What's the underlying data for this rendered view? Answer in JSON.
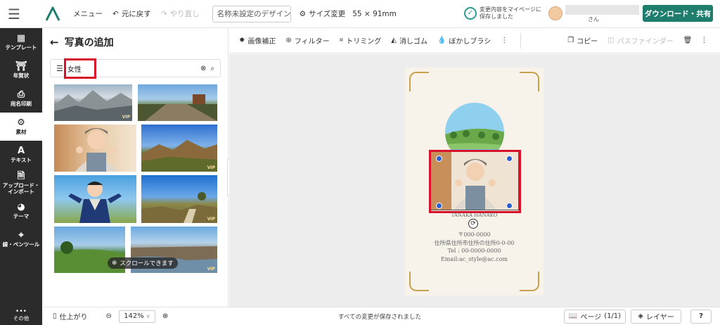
{
  "header": {
    "menu_label": "メニュー",
    "undo_label": "元に戻す",
    "redo_label": "やり直し",
    "design_title": "名称未設定のデザイン",
    "size_label": "サイズ変更",
    "size_value": "55 × 91mm",
    "saved_line1": "変更内容をマイページに",
    "saved_line2": "保存しました",
    "user_suffix": "さん",
    "download_label": "ダウンロード・共有",
    "brand_color": "#1f7d6e"
  },
  "sidebar": {
    "items": [
      {
        "icon": "template-icon",
        "label": "テンプレート"
      },
      {
        "icon": "newyear-card-icon",
        "label": "年賀状"
      },
      {
        "icon": "printer-icon",
        "label": "宛名印刷"
      },
      {
        "icon": "gear-icon",
        "label": "素材"
      },
      {
        "icon": "text-icon",
        "label": "テキスト"
      },
      {
        "icon": "upload-icon",
        "label": "アップロード・インポート"
      },
      {
        "icon": "palette-icon",
        "label": "テーマ"
      },
      {
        "icon": "pen-tool-icon",
        "label": "線・ペンツール"
      }
    ],
    "other_label": "その他"
  },
  "panel": {
    "title": "写真の追加",
    "search_value": "女性",
    "vip_badge": "VIP",
    "scroll_hint": "スクロールできます"
  },
  "toolbar": {
    "adjust": "画像補正",
    "filter": "フィルター",
    "trim": "トリミング",
    "eraser": "消しゴム",
    "blur": "ぼかしブラシ",
    "copy": "コピー",
    "pathfinder": "パスファインダー"
  },
  "card": {
    "name": "TANAKA HANAKO",
    "zip": "〒000-0000",
    "address": "住所県住所市住所の住所0-0-00",
    "tel": "Tel : 00-0000-0000",
    "email": "Email:ac_style@ac.com",
    "accent_color": "#c9a14e"
  },
  "footer": {
    "finish_label": "仕上がり",
    "zoom_value": "142%",
    "status": "すべての変更が保存されました",
    "page_label": "ページ",
    "page_value": "(1/1)",
    "layer_label": "レイヤー",
    "help": "?"
  }
}
